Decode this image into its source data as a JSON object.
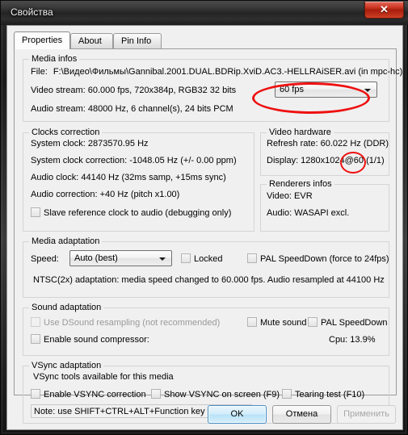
{
  "window": {
    "title": "Свойства",
    "close_glyph": "✕"
  },
  "tabs": [
    {
      "label": "Properties",
      "active": true
    },
    {
      "label": "About",
      "active": false
    },
    {
      "label": "Pin Info",
      "active": false
    }
  ],
  "media_infos": {
    "legend": "Media infos",
    "file_label": "File:",
    "file_value": "F:\\Видео\\Фильмы\\Gannibal.2001.DUAL.BDRip.XviD.AC3.-HELLRAiSER.avi (in mpc-hc)",
    "video_stream": "Video stream:  60.000 fps, 720x384p, RGB32 32 bits",
    "audio_stream": "Audio stream:  48000 Hz, 6 channel(s), 24 bits PCM",
    "fps_combo_value": "60 fps"
  },
  "clocks_correction": {
    "legend": "Clocks correction",
    "system_clock": "System clock:  2873570.95 Hz",
    "system_clock_correction": "System clock correction:  -1048.05 Hz (+/- 0.00 ppm)",
    "audio_clock": "Audio clock:  44140 Hz (32ms samp, +15ms sync)",
    "audio_correction": "Audio correction:  +40 Hz (pitch x1.00)",
    "slave_checkbox_label": "Slave reference clock to audio (debugging only)",
    "slave_checked": false
  },
  "video_hardware": {
    "legend": "Video hardware",
    "refresh_rate": "Refresh rate:  60.022 Hz (DDR)",
    "display": "Display:  1280x1024@60 (1/1)"
  },
  "renderers_infos": {
    "legend": "Renderers infos",
    "video": "Video: EVR",
    "audio": "Audio: WASAPI excl."
  },
  "media_adaptation": {
    "legend": "Media adaptation",
    "speed_label": "Speed:",
    "speed_value": "Auto (best)",
    "locked_label": "Locked",
    "locked_checked": false,
    "pal_speeddown_label": "PAL SpeedDown (force to 24fps)",
    "pal_speeddown_checked": false,
    "adaptation_note": "NTSC(2x) adaptation: media speed changed to 60.000 fps. Audio resampled at 44100 Hz"
  },
  "sound_adaptation": {
    "legend": "Sound adaptation",
    "dsound_label": "Use DSound resampling (not recommended)",
    "dsound_checked": false,
    "dsound_disabled": true,
    "mute_label": "Mute sound",
    "mute_checked": false,
    "pal_speeddown_label": "PAL SpeedDown",
    "pal_speeddown_checked": false,
    "compressor_label": "Enable sound compressor:",
    "compressor_checked": false,
    "cpu_label": "Cpu:  13.9%"
  },
  "vsync_adaptation": {
    "legend": "VSync adaptation",
    "availability": "VSync tools available for this media",
    "enable_vsync_label": "Enable VSYNC correction",
    "enable_vsync_checked": false,
    "show_vsync_label": "Show VSYNC on screen (F9)",
    "show_vsync_checked": false,
    "tearing_test_label": "Tearing test (F10)",
    "tearing_test_checked": false,
    "note": "Note: use SHIFT+CTRL+ALT+Function key for shortcuts"
  },
  "buttons": {
    "ok": "OK",
    "cancel": "Отмена",
    "apply": "Применить",
    "apply_disabled": true
  },
  "annotations": {
    "color": "#ee1111",
    "marks": [
      {
        "target": "fps-combo"
      },
      {
        "target": "display-refresh-value"
      }
    ]
  }
}
